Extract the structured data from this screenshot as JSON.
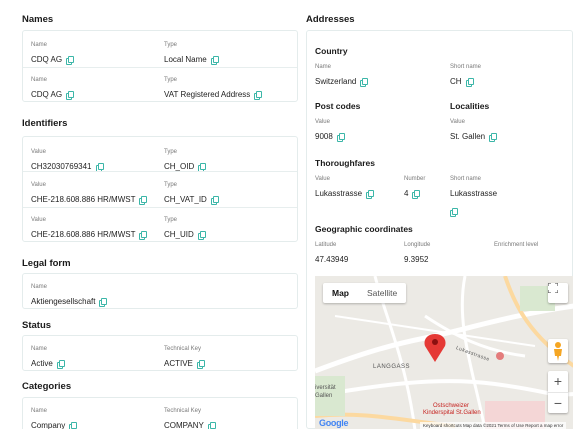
{
  "names": {
    "title": "Names",
    "rows": [
      {
        "name_label": "Name",
        "name_value": "CDQ AG",
        "type_label": "Type",
        "type_value": "Local Name"
      },
      {
        "name_label": "Name",
        "name_value": "CDQ AG",
        "type_label": "Type",
        "type_value": "VAT Registered Address"
      }
    ]
  },
  "identifiers": {
    "title": "Identifiers",
    "rows": [
      {
        "value_label": "Value",
        "value": "CH32030769341",
        "type_label": "Type",
        "type_value": "CH_OID"
      },
      {
        "value_label": "Value",
        "value": "CHE-218.608.886 HR/MWST",
        "type_label": "Type",
        "type_value": "CH_VAT_ID"
      },
      {
        "value_label": "Value",
        "value": "CHE-218.608.886 HR/MWST",
        "type_label": "Type",
        "type_value": "CH_UID"
      }
    ]
  },
  "legal_form": {
    "title": "Legal form",
    "name_label": "Name",
    "name_value": "Aktiengesellschaft"
  },
  "status": {
    "title": "Status",
    "name_label": "Name",
    "name_value": "Active",
    "key_label": "Technical Key",
    "key_value": "ACTIVE"
  },
  "categories": {
    "title": "Categories",
    "name_label": "Name",
    "name_value": "Company",
    "key_label": "Technical Key",
    "key_value": "COMPANY"
  },
  "addresses": {
    "title": "Addresses",
    "country": {
      "title": "Country",
      "name_label": "Name",
      "name_value": "Switzerland",
      "short_label": "Short name",
      "short_value": "CH"
    },
    "post_codes": {
      "title": "Post codes",
      "value_label": "Value",
      "value": "9008"
    },
    "localities": {
      "title": "Localities",
      "value_label": "Value",
      "value": "St. Gallen"
    },
    "thoroughfares": {
      "title": "Thoroughfares",
      "value_label": "Value",
      "value": "Lukasstrasse",
      "number_label": "Number",
      "number": "4",
      "short_label": "Short name",
      "short_value": "Lukasstrasse"
    },
    "geo": {
      "title": "Geographic coordinates",
      "lat_label": "Latitude",
      "lat": "47.43949",
      "lon_label": "Longitude",
      "lon": "9.3952",
      "enrich_label": "Enrichment level",
      "enrich": ""
    }
  },
  "map": {
    "tab_map": "Map",
    "tab_satellite": "Satellite",
    "fullscreen_icon": "fullscreen-icon",
    "zoom_in": "+",
    "zoom_out": "−",
    "place_langgass": "LANGGASS",
    "place_universitat": "iversität",
    "place_gallen": "Gallen",
    "place_hospital_1": "Ostschweizer",
    "place_hospital_2": "Kinderspital St.Gallen",
    "street_label": "Lukasstrasse",
    "google": "Google",
    "footer": "Keyboard shortcuts   Map data ©2021   Terms of Use   Report a map error",
    "colors": {
      "marker": "#e53935",
      "accent": "#3bb6a8"
    }
  }
}
